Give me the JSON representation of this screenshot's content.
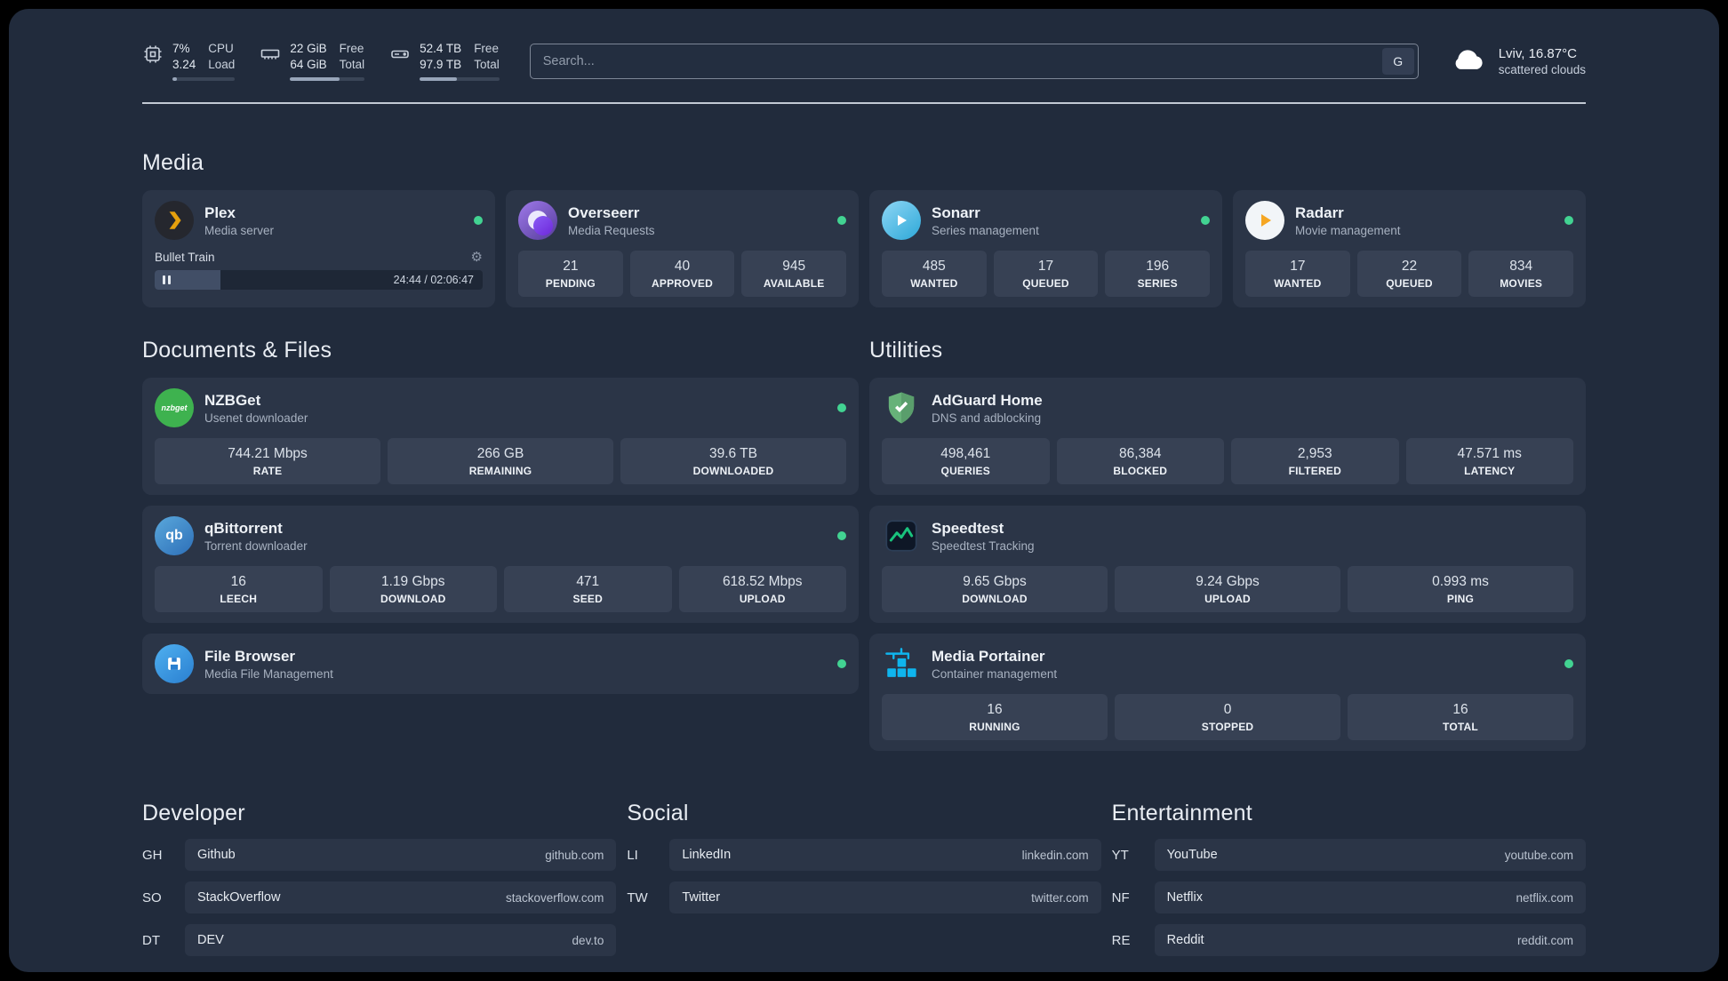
{
  "colors": {
    "status_online": "#42d392",
    "page_bg": "#212b3c",
    "card_bg": "#2b3547",
    "tile_bg": "#374154"
  },
  "topbar": {
    "cpu": {
      "value": "7%",
      "sub": "3.24",
      "label_top": "CPU",
      "label_bottom": "Load",
      "percent": 7
    },
    "ram": {
      "value": "22 GiB",
      "sub": "64 GiB",
      "label_top": "Free",
      "label_bottom": "Total",
      "percent": 66
    },
    "disk": {
      "value": "52.4 TB",
      "sub": "97.9 TB",
      "label_top": "Free",
      "label_bottom": "Total",
      "percent": 47
    },
    "search": {
      "placeholder": "Search...",
      "provider_label": "G"
    },
    "weather": {
      "location": "Lviv, 16.87°C",
      "condition": "scattered clouds"
    }
  },
  "sections": {
    "media": "Media",
    "documents": "Documents & Files",
    "utilities": "Utilities",
    "developer": "Developer",
    "social": "Social",
    "entertainment": "Entertainment"
  },
  "services": {
    "plex": {
      "name": "Plex",
      "desc": "Media server",
      "now_playing": "Bullet Train",
      "time": "24:44 / 02:06:47",
      "progress_percent": 20
    },
    "overseerr": {
      "name": "Overseerr",
      "desc": "Media Requests",
      "stats": [
        {
          "value": "21",
          "label": "PENDING"
        },
        {
          "value": "40",
          "label": "APPROVED"
        },
        {
          "value": "945",
          "label": "AVAILABLE"
        }
      ]
    },
    "sonarr": {
      "name": "Sonarr",
      "desc": "Series management",
      "stats": [
        {
          "value": "485",
          "label": "WANTED"
        },
        {
          "value": "17",
          "label": "QUEUED"
        },
        {
          "value": "196",
          "label": "SERIES"
        }
      ]
    },
    "radarr": {
      "name": "Radarr",
      "desc": "Movie management",
      "stats": [
        {
          "value": "17",
          "label": "WANTED"
        },
        {
          "value": "22",
          "label": "QUEUED"
        },
        {
          "value": "834",
          "label": "MOVIES"
        }
      ]
    },
    "nzbget": {
      "name": "NZBGet",
      "desc": "Usenet downloader",
      "icon_text": "nzbget",
      "stats": [
        {
          "value": "744.21 Mbps",
          "label": "RATE"
        },
        {
          "value": "266 GB",
          "label": "REMAINING"
        },
        {
          "value": "39.6 TB",
          "label": "DOWNLOADED"
        }
      ]
    },
    "qbittorrent": {
      "name": "qBittorrent",
      "desc": "Torrent downloader",
      "icon_text": "qb",
      "stats": [
        {
          "value": "16",
          "label": "LEECH"
        },
        {
          "value": "1.19 Gbps",
          "label": "DOWNLOAD"
        },
        {
          "value": "471",
          "label": "SEED"
        },
        {
          "value": "618.52 Mbps",
          "label": "UPLOAD"
        }
      ]
    },
    "filebrowser": {
      "name": "File Browser",
      "desc": "Media File Management"
    },
    "adguard": {
      "name": "AdGuard Home",
      "desc": "DNS and adblocking",
      "stats": [
        {
          "value": "498,461",
          "label": "QUERIES"
        },
        {
          "value": "86,384",
          "label": "BLOCKED"
        },
        {
          "value": "2,953",
          "label": "FILTERED"
        },
        {
          "value": "47.571 ms",
          "label": "LATENCY"
        }
      ]
    },
    "speedtest": {
      "name": "Speedtest",
      "desc": "Speedtest Tracking",
      "stats": [
        {
          "value": "9.65 Gbps",
          "label": "DOWNLOAD"
        },
        {
          "value": "9.24 Gbps",
          "label": "UPLOAD"
        },
        {
          "value": "0.993 ms",
          "label": "PING"
        }
      ]
    },
    "portainer": {
      "name": "Media Portainer",
      "desc": "Container management",
      "stats": [
        {
          "value": "16",
          "label": "RUNNING"
        },
        {
          "value": "0",
          "label": "STOPPED"
        },
        {
          "value": "16",
          "label": "TOTAL"
        }
      ]
    }
  },
  "bookmarks": {
    "developer": [
      {
        "abbr": "GH",
        "name": "Github",
        "domain": "github.com"
      },
      {
        "abbr": "SO",
        "name": "StackOverflow",
        "domain": "stackoverflow.com"
      },
      {
        "abbr": "DT",
        "name": "DEV",
        "domain": "dev.to"
      }
    ],
    "social": [
      {
        "abbr": "LI",
        "name": "LinkedIn",
        "domain": "linkedin.com"
      },
      {
        "abbr": "TW",
        "name": "Twitter",
        "domain": "twitter.com"
      }
    ],
    "entertainment": [
      {
        "abbr": "YT",
        "name": "YouTube",
        "domain": "youtube.com"
      },
      {
        "abbr": "NF",
        "name": "Netflix",
        "domain": "netflix.com"
      },
      {
        "abbr": "RE",
        "name": "Reddit",
        "domain": "reddit.com"
      }
    ]
  }
}
